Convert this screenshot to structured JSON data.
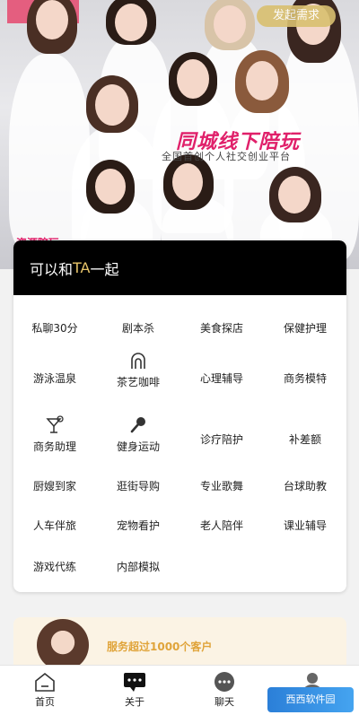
{
  "banner": {
    "publish_button": "发起需求",
    "title": "同城线下陪玩",
    "subtitle": "全国首创个人社交创业平台",
    "corner_text": "资源陪玩"
  },
  "card": {
    "title_prefix": "可以和",
    "title_highlight": "TA",
    "title_suffix": "一起",
    "services": [
      {
        "label": "私聊30分",
        "icon": ""
      },
      {
        "label": "剧本杀",
        "icon": ""
      },
      {
        "label": "美食探店",
        "icon": ""
      },
      {
        "label": "保健护理",
        "icon": ""
      },
      {
        "label": "游泳温泉",
        "icon": ""
      },
      {
        "label": "茶艺咖啡",
        "icon": "arch-icon"
      },
      {
        "label": "心理辅导",
        "icon": ""
      },
      {
        "label": "商务模特",
        "icon": ""
      },
      {
        "label": "商务助理",
        "icon": "cocktail-icon"
      },
      {
        "label": "健身运动",
        "icon": "microphone-icon"
      },
      {
        "label": "诊疗陪护",
        "icon": ""
      },
      {
        "label": "补差额",
        "icon": ""
      },
      {
        "label": "厨嫂到家",
        "icon": ""
      },
      {
        "label": "逛街导购",
        "icon": ""
      },
      {
        "label": "专业歌舞",
        "icon": ""
      },
      {
        "label": "台球助教",
        "icon": ""
      },
      {
        "label": "人车伴旅",
        "icon": ""
      },
      {
        "label": "宠物看护",
        "icon": ""
      },
      {
        "label": "老人陪伴",
        "icon": ""
      },
      {
        "label": "课业辅导",
        "icon": ""
      },
      {
        "label": "游戏代练",
        "icon": ""
      },
      {
        "label": "内部模拟",
        "icon": ""
      }
    ]
  },
  "promo": {
    "text": "服务超过1000个客户"
  },
  "tabs": [
    {
      "label": "首页",
      "icon": "home-icon"
    },
    {
      "label": "关于",
      "icon": "chat-bubble-icon"
    },
    {
      "label": "聊天",
      "icon": "message-dots-icon"
    },
    {
      "label": "",
      "icon": "user-icon"
    }
  ],
  "watermark": "西西软件园"
}
